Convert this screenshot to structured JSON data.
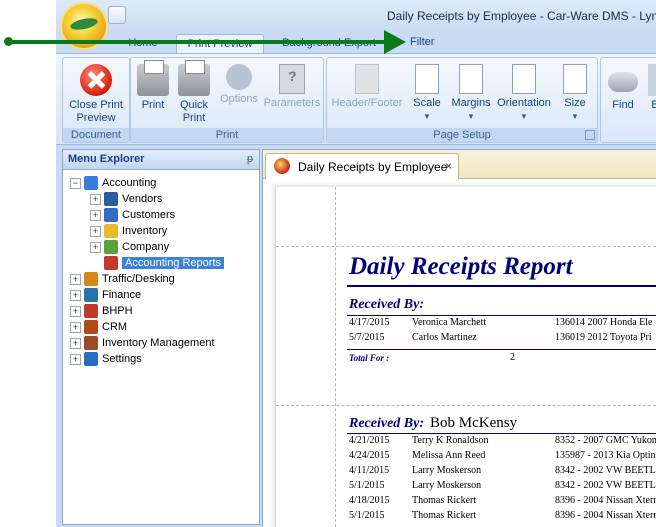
{
  "window": {
    "title": "Daily Receipts by Employee - Car-Ware DMS - Lynn"
  },
  "ribbon_tabs": [
    {
      "label": "Home",
      "active": false
    },
    {
      "label": "Print Preview",
      "active": true
    },
    {
      "label": "Background Export",
      "active": false
    }
  ],
  "filter_label": "Filter",
  "ribbon": {
    "groups": {
      "document": "Document",
      "print": "Print",
      "page_setup": "Page Setup"
    },
    "buttons": {
      "close_print_preview": "Close Print Preview",
      "print": "Print",
      "quick_print": "Quick Print",
      "options": "Options",
      "parameters": "Parameters",
      "header_footer": "Header/Footer",
      "scale": "Scale",
      "margins": "Margins",
      "orientation": "Orientation",
      "size": "Size",
      "find": "Find",
      "partial": "Bo"
    }
  },
  "menu_explorer": {
    "title": "Menu Explorer",
    "pin_glyph": "ᵽ",
    "items": [
      {
        "label": "Accounting",
        "level": 0,
        "expander": "−",
        "icon": "accounting-icon",
        "color": "#3a7bd5"
      },
      {
        "label": "Vendors",
        "level": 1,
        "expander": "+",
        "icon": "vendors-icon",
        "color": "#2c5aa0"
      },
      {
        "label": "Customers",
        "level": 1,
        "expander": "+",
        "icon": "customers-icon",
        "color": "#2f6cc2"
      },
      {
        "label": "Inventory",
        "level": 1,
        "expander": "+",
        "icon": "inventory-icon",
        "color": "#e8b92c"
      },
      {
        "label": "Company",
        "level": 1,
        "expander": "+",
        "icon": "company-icon",
        "color": "#5aa03c"
      },
      {
        "label": "Accounting Reports",
        "level": 1,
        "expander": "",
        "icon": "accounting-reports-icon",
        "color": "#c0392b",
        "selected": true
      },
      {
        "label": "Traffic/Desking",
        "level": 0,
        "expander": "+",
        "icon": "traffic-desking-icon",
        "color": "#d4881a"
      },
      {
        "label": "Finance",
        "level": 0,
        "expander": "+",
        "icon": "finance-icon",
        "color": "#2874a6"
      },
      {
        "label": "BHPH",
        "level": 0,
        "expander": "+",
        "icon": "bhph-icon",
        "color": "#c0392b"
      },
      {
        "label": "CRM",
        "level": 0,
        "expander": "+",
        "icon": "crm-icon",
        "color": "#b04a18"
      },
      {
        "label": "Inventory Management",
        "level": 0,
        "expander": "+",
        "icon": "inventory-management-icon",
        "color": "#9c4a2a"
      },
      {
        "label": "Settings",
        "level": 0,
        "expander": "+",
        "icon": "settings-icon",
        "color": "#2a6cc0"
      }
    ]
  },
  "doc_tab": {
    "label": "Daily Receipts by Employee",
    "close": "×"
  },
  "report": {
    "title": "Daily Receipts Report",
    "received_by_label": "Received By:",
    "total_for_label": "Total For :",
    "sections": [
      {
        "employee": "",
        "rows": [
          {
            "date": "4/17/2015",
            "customer": "Veronica  Marchett",
            "vehicle": "136014 2007 Honda Ele"
          },
          {
            "date": "5/7/2015",
            "customer": "Carlos  Martinez",
            "vehicle": "136019 2012 Toyota Pri"
          }
        ],
        "total": "2"
      },
      {
        "employee": "Bob McKensy",
        "rows": [
          {
            "date": "4/21/2015",
            "customer": "Terry K Ronaldson",
            "vehicle": "8352 - 2007 GMC Yukon"
          },
          {
            "date": "4/24/2015",
            "customer": "Melissa Ann Reed",
            "vehicle": "135987 - 2013 Kia Optin"
          },
          {
            "date": "4/11/2015",
            "customer": "Larry  Moskerson",
            "vehicle": "8342 - 2002 VW BEETL"
          },
          {
            "date": "5/1/2015",
            "customer": "Larry  Moskerson",
            "vehicle": "8342 - 2002 VW BEETL"
          },
          {
            "date": "4/18/2015",
            "customer": "Thomas  Rickert",
            "vehicle": "8396 - 2004 Nissan Xterr"
          },
          {
            "date": "5/1/2015",
            "customer": "Thomas  Rickert",
            "vehicle": "8396 - 2004 Nissan Xterr"
          }
        ]
      }
    ]
  }
}
